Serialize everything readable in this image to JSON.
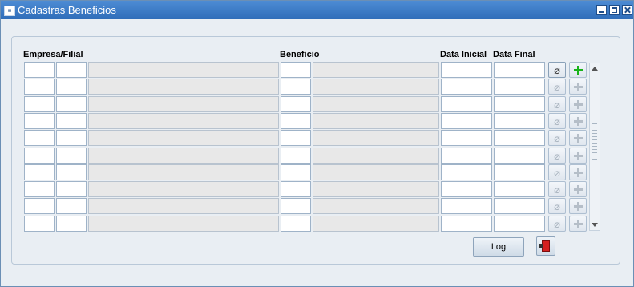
{
  "window": {
    "title": "Cadastras Beneficios",
    "app_icon": "oracle-forms-icon"
  },
  "table": {
    "headers": {
      "empresa_filial": "Empresa/Filial",
      "beneficio": "Beneficio",
      "data_inicial": "Data Inicial",
      "data_final": "Data Final"
    },
    "row_count": 10,
    "rows": [
      {
        "empresa": "",
        "filial": "",
        "empresa_nome": "",
        "beneficio": "",
        "beneficio_nome": "",
        "data_inicial": "",
        "data_final": ""
      },
      {
        "empresa": "",
        "filial": "",
        "empresa_nome": "",
        "beneficio": "",
        "beneficio_nome": "",
        "data_inicial": "",
        "data_final": ""
      },
      {
        "empresa": "",
        "filial": "",
        "empresa_nome": "",
        "beneficio": "",
        "beneficio_nome": "",
        "data_inicial": "",
        "data_final": ""
      },
      {
        "empresa": "",
        "filial": "",
        "empresa_nome": "",
        "beneficio": "",
        "beneficio_nome": "",
        "data_inicial": "",
        "data_final": ""
      },
      {
        "empresa": "",
        "filial": "",
        "empresa_nome": "",
        "beneficio": "",
        "beneficio_nome": "",
        "data_inicial": "",
        "data_final": ""
      },
      {
        "empresa": "",
        "filial": "",
        "empresa_nome": "",
        "beneficio": "",
        "beneficio_nome": "",
        "data_inicial": "",
        "data_final": ""
      },
      {
        "empresa": "",
        "filial": "",
        "empresa_nome": "",
        "beneficio": "",
        "beneficio_nome": "",
        "data_inicial": "",
        "data_final": ""
      },
      {
        "empresa": "",
        "filial": "",
        "empresa_nome": "",
        "beneficio": "",
        "beneficio_nome": "",
        "data_inicial": "",
        "data_final": ""
      },
      {
        "empresa": "",
        "filial": "",
        "empresa_nome": "",
        "beneficio": "",
        "beneficio_nome": "",
        "data_inicial": "",
        "data_final": ""
      },
      {
        "empresa": "",
        "filial": "",
        "empresa_nome": "",
        "beneficio": "",
        "beneficio_nome": "",
        "data_inicial": "",
        "data_final": ""
      }
    ],
    "active_row": 0
  },
  "buttons": {
    "log_label": "Log",
    "exit_icon": "exit-door-icon",
    "attach_icon": "paperclip-icon",
    "add_icon": "plus-icon"
  },
  "colors": {
    "titlebar": "#3a7bc8",
    "add_active": "#19b319"
  }
}
